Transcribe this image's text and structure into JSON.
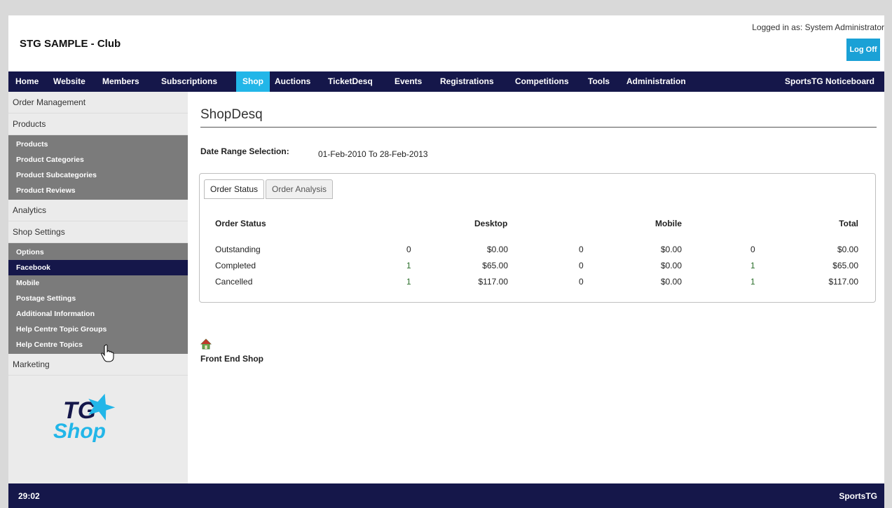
{
  "header": {
    "club_title": "STG SAMPLE - Club",
    "login_text": "Logged in as: System Administrator",
    "logoff_label": "Log Off"
  },
  "nav": {
    "items": [
      "Home",
      "Website",
      "Members",
      "Subscriptions",
      "Shop",
      "Auctions",
      "TicketDesq",
      "Events",
      "Registrations",
      "Competitions",
      "Tools",
      "Administration"
    ],
    "active": "Shop",
    "right_label": "SportsTG Noticeboard"
  },
  "sidebar": {
    "order_management": "Order Management",
    "products": "Products",
    "products_sub": [
      "Products",
      "Product Categories",
      "Product Subcategories",
      "Product Reviews"
    ],
    "analytics": "Analytics",
    "shop_settings": "Shop Settings",
    "shop_settings_sub": [
      "Options",
      "Facebook",
      "Mobile",
      "Postage Settings",
      "Additional Information",
      "Help Centre Topic Groups",
      "Help Centre Topics"
    ],
    "highlighted": "Facebook",
    "marketing": "Marketing",
    "logo_top": "TG",
    "logo_bottom": "Shop"
  },
  "main": {
    "title": "ShopDesq",
    "date_label": "Date Range Selection:",
    "date_value": "01-Feb-2010 To 28-Feb-2013",
    "tabs": [
      "Order Status",
      "Order Analysis"
    ],
    "table": {
      "headers": [
        "Order Status",
        "Desktop",
        "Mobile",
        "Total"
      ],
      "rows": [
        {
          "status": "Outstanding",
          "desk_count": "0",
          "desk_amount": "$0.00",
          "mob_count": "0",
          "mob_amount": "$0.00",
          "tot_count": "0",
          "tot_amount": "$0.00"
        },
        {
          "status": "Completed",
          "desk_count": "1",
          "desk_amount": "$65.00",
          "mob_count": "0",
          "mob_amount": "$0.00",
          "tot_count": "1",
          "tot_amount": "$65.00"
        },
        {
          "status": "Cancelled",
          "desk_count": "1",
          "desk_amount": "$117.00",
          "mob_count": "0",
          "mob_amount": "$0.00",
          "tot_count": "1",
          "tot_amount": "$117.00"
        }
      ]
    },
    "front_shop_label": "Front End Shop"
  },
  "footer": {
    "left": "29:02",
    "right": "SportsTG"
  },
  "colors": {
    "nav_bg": "#15174a",
    "accent": "#22b6e8",
    "logoff_bg": "#1aa1d6"
  }
}
